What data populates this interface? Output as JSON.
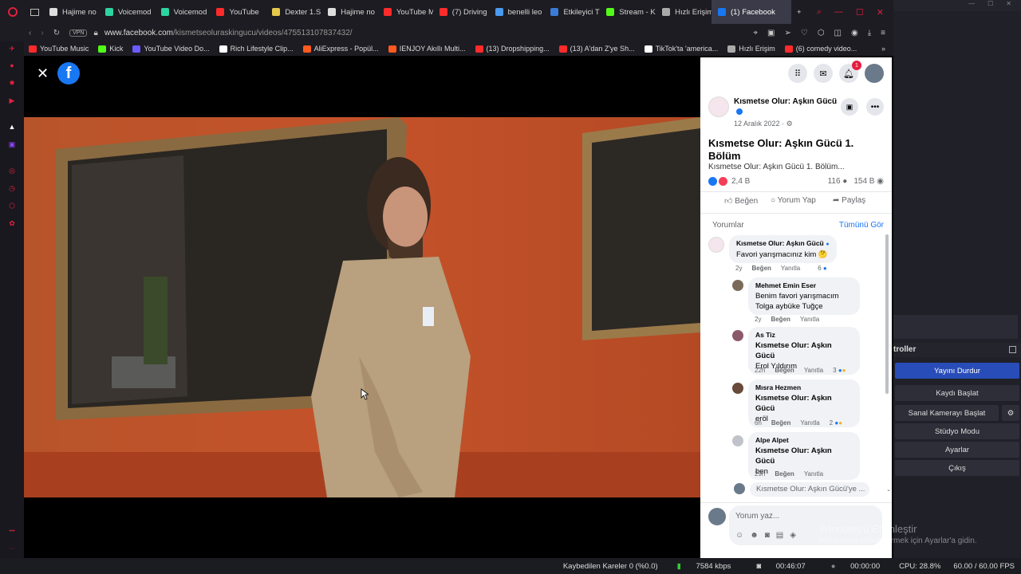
{
  "browser": {
    "tabs": [
      {
        "label": "Hajime no",
        "color": "#dddddd"
      },
      {
        "label": "Voicemod",
        "color": "#2bd4a0"
      },
      {
        "label": "Voicemod",
        "color": "#2bd4a0"
      },
      {
        "label": "YouTube",
        "color": "#ff2b2b"
      },
      {
        "label": "Dexter 1.S",
        "color": "#e6c84a"
      },
      {
        "label": "Hajime no",
        "color": "#dddddd"
      },
      {
        "label": "YouTube M",
        "color": "#ff2b2b"
      },
      {
        "label": "(7) Driving",
        "color": "#ff2b2b"
      },
      {
        "label": "benelli leo",
        "color": "#4a9af0"
      },
      {
        "label": "Etkileyici T",
        "color": "#3a7bd5"
      },
      {
        "label": "Stream - K",
        "color": "#53fc18"
      },
      {
        "label": "Hızlı Erişim",
        "color": "#aaaaaa"
      },
      {
        "label": "(1) Facebook",
        "color": "#1877f2"
      }
    ],
    "url_host": "www.facebook.com",
    "url_path": "/kismetseoluraskingucu/videos/475513107837432/",
    "vpn_badge": "VPN",
    "bookmarks": [
      {
        "label": "YouTube Music",
        "color": "#ff2b2b"
      },
      {
        "label": "Kick",
        "color": "#53fc18"
      },
      {
        "label": "YouTube Video Do...",
        "color": "#6a5cff"
      },
      {
        "label": "Rich Lifestyle Clip...",
        "color": "#ffffff"
      },
      {
        "label": "AliExpress - Popül...",
        "color": "#ff5a1f"
      },
      {
        "label": "IENJOY Akıllı Multi...",
        "color": "#ff5a1f"
      },
      {
        "label": "(13) Dropshipping...",
        "color": "#ff2b2b"
      },
      {
        "label": "(13) A'dan Z'ye Sh...",
        "color": "#ff2b2b"
      },
      {
        "label": "TikTok'ta 'america...",
        "color": "#ffffff"
      },
      {
        "label": "Hızlı Erişim",
        "color": "#aaaaaa"
      },
      {
        "label": "(6) comedy video...",
        "color": "#ff2b2b"
      }
    ]
  },
  "post": {
    "page_name": "Kısmetse Olur: Aşkın Gücü",
    "date": "12 Aralık 2022 ·",
    "title": "Kısmetse Olur: Aşkın Gücü 1. Bölüm",
    "description": "Kısmetse Olur: Aşkın Gücü 1. Bölüm...",
    "reactions": "2,4 B",
    "comments_count": "116",
    "views": "154 B",
    "like_label": "Beğen",
    "comment_label": "Yorum Yap",
    "share_label": "Paylaş",
    "notif_badge": "1"
  },
  "comments": {
    "header": "Yorumlar",
    "see_all": "Tümünü Gör",
    "items": [
      {
        "author": "Kısmetse Olur: Aşkın Gücü",
        "text": "Favori yarışmacınız kim 🤔",
        "time": "2y",
        "like": "Beğen",
        "reply": "Yanıtla",
        "count": "6"
      },
      {
        "author": "Mehmet Emin Eser",
        "text": "Benim favori yarışmacım",
        "text2": "Tolga aybüke Tuğçe",
        "time": "2y",
        "like": "Beğen",
        "reply": "Yanıtla"
      },
      {
        "author": "As Tiz",
        "tag": "Kısmetse Olur: Aşkın Gücü",
        "text": "Erol Yıldırım",
        "time": "22h",
        "like": "Beğen",
        "reply": "Yanıtla",
        "count": "3"
      },
      {
        "author": "Mısra Hezmen",
        "tag": "Kısmetse Olur: Aşkın Gücü",
        "text": "eröl",
        "time": "6h",
        "like": "Beğen",
        "reply": "Yanıtla",
        "count": "2"
      },
      {
        "author": "Alpe Alpet",
        "tag": "Kısmetse Olur: Aşkın Gücü",
        "text": "ben",
        "time": "29h",
        "like": "Beğen",
        "reply": "Yanıtla"
      }
    ],
    "reply_placeholder": "Kısmetse Olur: Aşkın Gücü'ye ...",
    "comment_placeholder": "Yorum yaz..."
  },
  "watermark": {
    "line1": "Windows'u Etkinleştir",
    "line2": "Windows'u etkinleştirmek için Ayarlar'a gidin."
  },
  "obs": {
    "section_title": "troller",
    "buttons": {
      "stop_stream": "Yayını Durdur",
      "start_record": "Kaydı Başlat",
      "virtual_cam": "Sanal Kamerayı Başlat",
      "studio_mode": "Stüdyo Modu",
      "settings": "Ayarlar",
      "exit": "Çıkış"
    },
    "status": {
      "dropped": "Kaybedilen Kareler 0 (%0.0)",
      "bitrate": "7584 kbps",
      "stream_time": "00:46:07",
      "record_time": "00:00:00",
      "cpu": "CPU: 28.8%",
      "fps": "60.00 / 60.00 FPS"
    }
  }
}
